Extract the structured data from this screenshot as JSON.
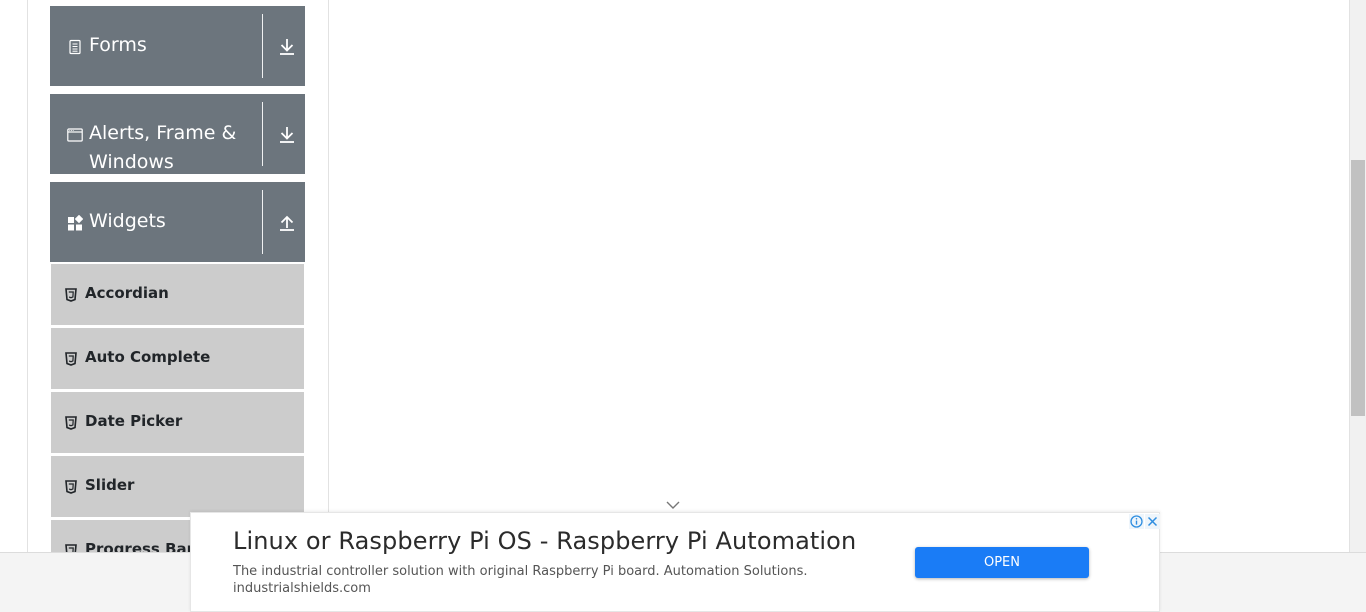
{
  "sidebar": {
    "groups": [
      {
        "label": "Forms",
        "icon": "document-icon",
        "toggle": "download-arrow-icon"
      },
      {
        "label": "Alerts, Frame & Windows",
        "icon": "window-icon",
        "toggle": "download-arrow-icon"
      },
      {
        "label": "Widgets",
        "icon": "widgets-icon",
        "toggle": "upload-arrow-icon"
      }
    ],
    "widget_items": [
      {
        "label": "Accordian",
        "icon": "html5-icon"
      },
      {
        "label": "Auto Complete",
        "icon": "html5-icon"
      },
      {
        "label": "Date Picker",
        "icon": "html5-icon"
      },
      {
        "label": "Slider",
        "icon": "html5-icon"
      },
      {
        "label": "Progress Bar",
        "icon": "html5-icon"
      }
    ]
  },
  "ad": {
    "title": "Linux or Raspberry Pi OS - Raspberry Pi Automation",
    "description": "The industrial controller solution with original Raspberry Pi board. Automation Solutions.",
    "domain": "industrialshields.com",
    "button_label": "OPEN",
    "button_color": "#1a7cf6"
  },
  "colors": {
    "group_header_bg": "#6c757d",
    "menu_item_bg": "#cccccc"
  }
}
